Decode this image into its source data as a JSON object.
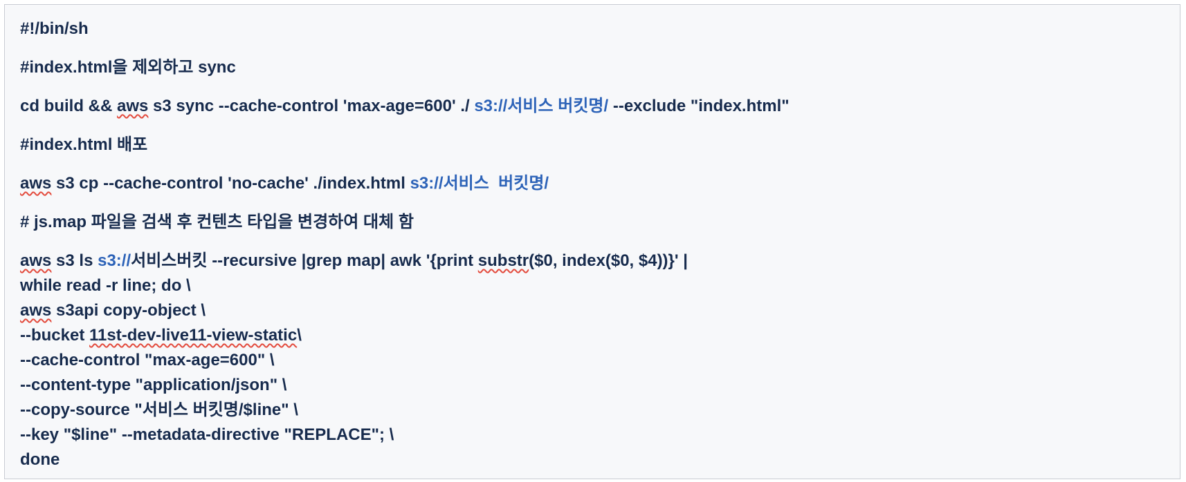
{
  "script": {
    "shebang": "#!/bin/sh",
    "comment_sync": "#index.html을 제외하고 sync",
    "sync": {
      "pre": "cd build && ",
      "aws": "aws",
      "mid": " s3 sync --cache-control 'max-age=600' ./ ",
      "bucket": "s3://서비스 버킷명/",
      "post": " --exclude \"index.html\""
    },
    "comment_deploy": "#index.html 배포",
    "cp": {
      "aws": "aws",
      "mid": " s3 cp --cache-control 'no-cache' ./index.html ",
      "bucket": "s3://서비스  버킷명/"
    },
    "comment_map": "# js.map 파일을 검색 후 컨텐츠 타입을 변경하여 대체 함",
    "ls": {
      "aws": "aws",
      "mid": " s3 ls ",
      "s3prefix": "s3://",
      "rest1": "서비스버킷 --recursive |grep map| awk '{print ",
      "substr": "substr",
      "rest2": "($0, index($0, $4))}' |"
    },
    "while_line": "while read -r line; do \\",
    "copy_obj": {
      "aws": "aws",
      "rest": " s3api copy-object \\"
    },
    "bucket_opt": {
      "pre": "--bucket ",
      "name": "11st-dev-live11-view-static",
      "post": "\\"
    },
    "cache_opt": "--cache-control \"max-age=600\" \\",
    "content_type_opt": "--content-type \"application/json\" \\",
    "copy_source_opt": "--copy-source \"서비스 버킷명/$line\" \\",
    "key_opt": "--key \"$line\" --metadata-directive \"REPLACE\"; \\",
    "done": "done"
  },
  "colors": {
    "text": "#172b4d",
    "link": "#2d63b8",
    "spellcheck": "#e34a3c",
    "panel_bg": "#f7f8fa",
    "panel_border": "#c9ccd3"
  }
}
